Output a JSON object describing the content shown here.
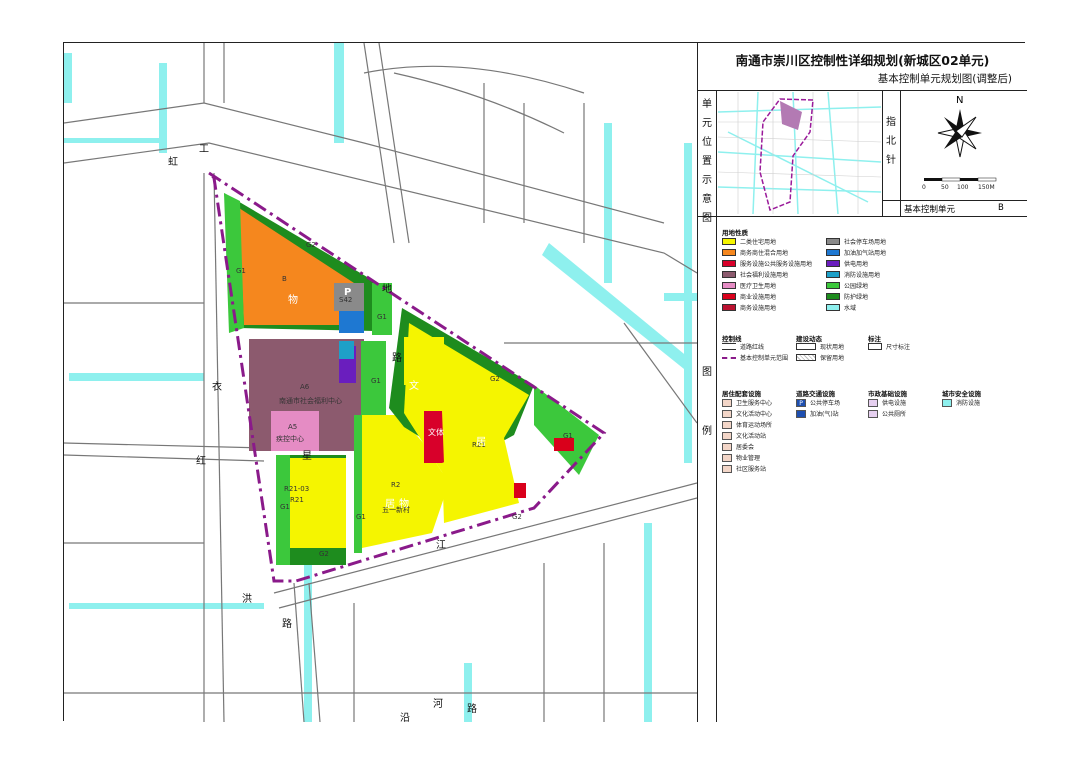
{
  "title": {
    "main": "南通市崇川区控制性详细规划(新城区02单元)",
    "sub": "基本控制单元规划图(调整后)"
  },
  "side_labels": {
    "location": [
      "单",
      "元",
      "位",
      "置",
      "示",
      "意",
      "图"
    ],
    "diagram": [
      "图",
      "例"
    ],
    "north": [
      "指",
      "北",
      "针"
    ]
  },
  "north": {
    "letter": "N",
    "scale_ticks": [
      "0",
      "50",
      "100",
      "150M"
    ]
  },
  "unit": {
    "label": "基本控制单元",
    "value": "B"
  },
  "legend": {
    "land_use_header": "用地性质",
    "land_use_left": [
      {
        "label": "二类住宅用地",
        "color": "#f5f500"
      },
      {
        "label": "商务商住混合用地",
        "color": "#f5871e"
      },
      {
        "label": "服务设施公共服务设施用地",
        "color": "#d8002a"
      },
      {
        "label": "社会福利设施用地",
        "color": "#8c5a6e"
      },
      {
        "label": "医疗卫生用地",
        "color": "#e58cc4"
      },
      {
        "label": "商业设施用地",
        "color": "#d9001b"
      },
      {
        "label": "商务设施用地",
        "color": "#bb1130"
      }
    ],
    "land_use_right": [
      {
        "label": "社会停车场用地",
        "color": "#8a8a8a"
      },
      {
        "label": "加油加气站用地",
        "color": "#1e78d2"
      },
      {
        "label": "供电用地",
        "color": "#6a1ebe"
      },
      {
        "label": "消防设施用地",
        "color": "#1ea0c8"
      },
      {
        "label": "公园绿地",
        "color": "#3cc83c"
      },
      {
        "label": "防护绿地",
        "color": "#1e8c1e"
      },
      {
        "label": "水域",
        "color": "#8ef0ee"
      }
    ],
    "control_header": "控制线",
    "control_items": [
      "道路红线",
      "基本控制单元范围"
    ],
    "dynamic_header": "建设动态",
    "dynamic_items": [
      "现状用地",
      "保留用地"
    ],
    "dim_header": "标注",
    "dim_items": [
      "尺寸标注"
    ],
    "residential_header": "居住配套设施",
    "residential_items": [
      "卫生服务中心",
      "文化活动中心",
      "体育运动场所",
      "文化活动站",
      "居委会",
      "物业管理",
      "社区服务站"
    ],
    "traffic_header": "道路交通设施",
    "traffic_items": [
      "公共停车场",
      "加油(气)站"
    ],
    "utility_header": "市政基础设施",
    "utility_items": [
      "供电设施",
      "公共厕所"
    ],
    "safety_header": "城市安全设施",
    "safety_items": [
      "消防设施"
    ]
  },
  "roads": [
    {
      "name": "工",
      "angle": 0
    },
    {
      "name": "虹",
      "angle": 0
    },
    {
      "name": "衣",
      "angle": 0
    },
    {
      "name": "红",
      "angle": 0
    },
    {
      "name": "星",
      "angle": 0
    },
    {
      "name": "洪",
      "angle": 0
    },
    {
      "name": "路",
      "angle": 0
    },
    {
      "name": "江",
      "angle": 0
    },
    {
      "name": "路",
      "angle": 0
    },
    {
      "name": "地",
      "angle": 0
    },
    {
      "name": "沿",
      "angle": 0
    },
    {
      "name": "河",
      "angle": 0
    },
    {
      "name": "路",
      "angle": 0
    }
  ],
  "parcels": {
    "g1_a": "G1",
    "g2_a": "G2",
    "b_label": "B",
    "s42": "S42",
    "g1_b": "G1",
    "g1_c": "G1",
    "g2_b": "G2",
    "a6": "A6",
    "a6_name": "南通市社会福利中心",
    "a5": "A5",
    "a5_name": "疾控中心",
    "r21_a": "R21",
    "r21_code": "R21-03",
    "g1_d": "G1",
    "g2_c": "G2",
    "r2": "R2",
    "r2_name": "五一新村",
    "r21_b": "R21",
    "g1_e": "G1",
    "g2_d": "G2",
    "g1_f": "G1"
  },
  "map_icons": {
    "wu_a": "物",
    "wu_b": "物",
    "wen": "文",
    "ju": "居",
    "ju2": "居",
    "wen_pei": "文体",
    "p": "P"
  }
}
